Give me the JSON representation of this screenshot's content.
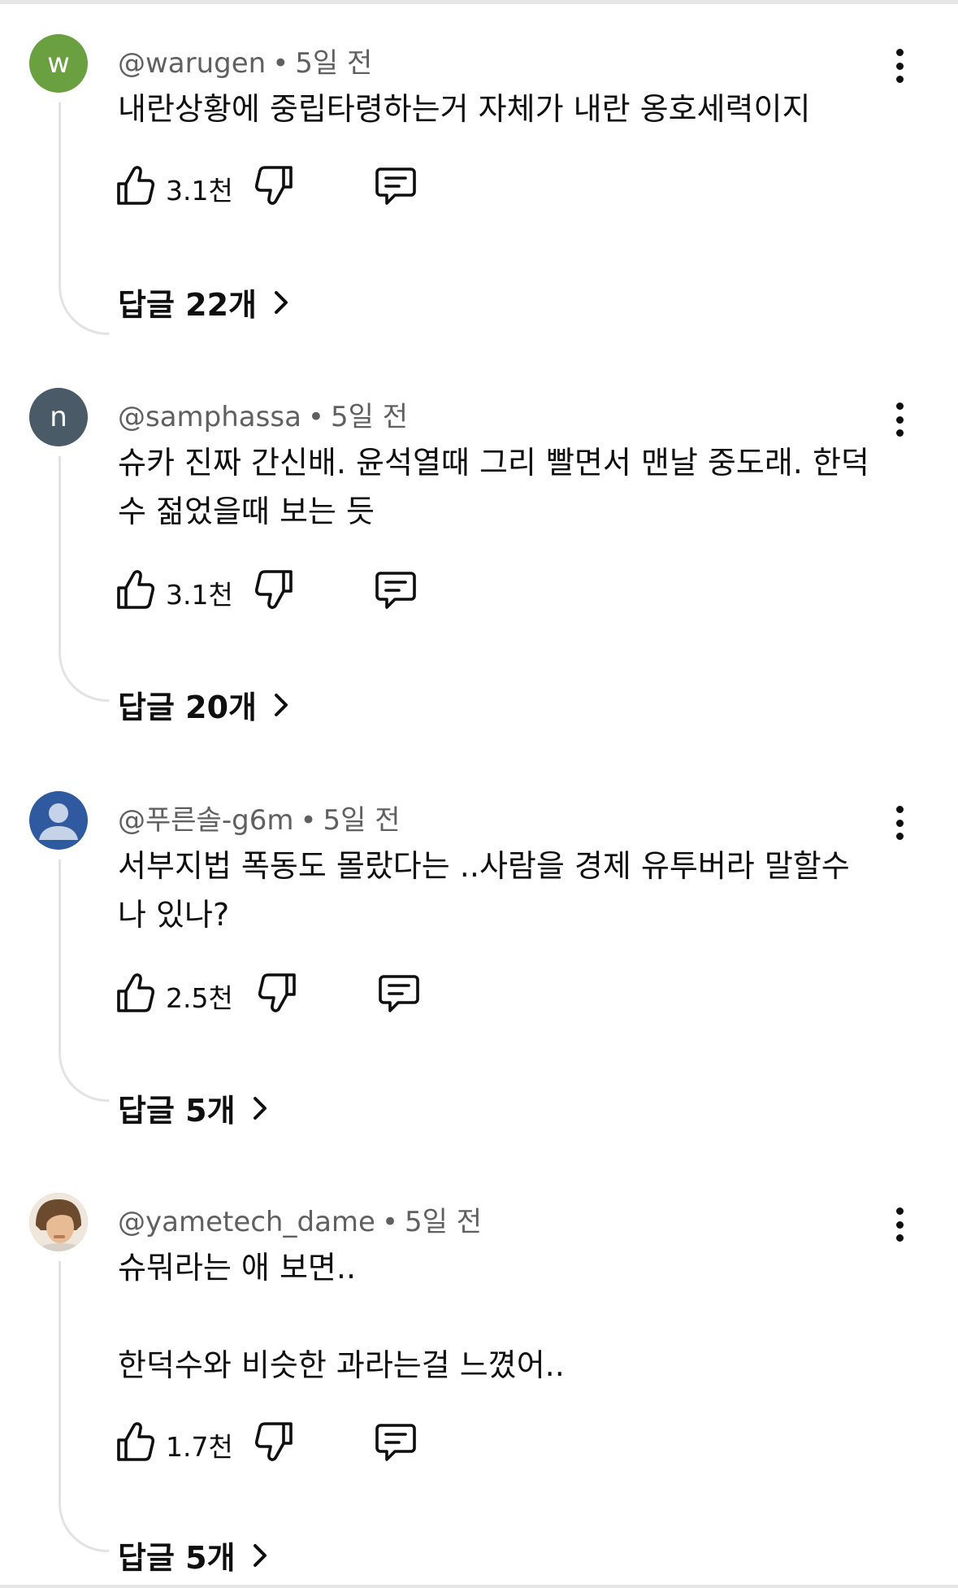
{
  "comments": [
    {
      "avatar_letter": "w",
      "avatar_color": "#6aa040",
      "author": "@warugen",
      "time": "5일 전",
      "lines": [
        "내란상황에 중립타령하는거 자체가 내란 옹호세력이지"
      ],
      "likes": "3.1천",
      "replies": "답글 22개"
    },
    {
      "avatar_letter": "n",
      "avatar_color": "#4a5a66",
      "author": "@samphassa",
      "time": "5일 전",
      "lines": [
        "슈카 진짜 간신배. 윤석열때 그리 빨면서 맨날 중도래. 한덕",
        "수 젊었을때 보는 듯"
      ],
      "likes": "3.1천",
      "replies": "답글 20개"
    },
    {
      "avatar_letter": "",
      "avatar_color": "#2f5aa0",
      "author": "@푸른솔-g6m",
      "time": "5일 전",
      "lines": [
        "서부지법 폭동도 몰랐다는 ..사람을 경제 유투버라 말할수",
        "나 있나?"
      ],
      "likes": "2.5천",
      "replies": "답글 5개"
    },
    {
      "avatar_letter": "",
      "avatar_color": "#c9a27a",
      "author": "@yametech_dame",
      "time": "5일 전",
      "lines": [
        "슈뭐라는 애 보면..",
        "",
        "한덕수와 비슷한 과라는걸 느꼈어.."
      ],
      "likes": "1.7천",
      "replies": "답글 5개"
    }
  ],
  "colors": {
    "text_primary": "#0f0f0f",
    "text_secondary": "#606060",
    "thread_line": "#e3e3e3"
  },
  "icons": [
    "like-icon",
    "dislike-icon",
    "reply-icon",
    "more-vert-icon",
    "chevron-right-icon",
    "default-user-icon"
  ]
}
